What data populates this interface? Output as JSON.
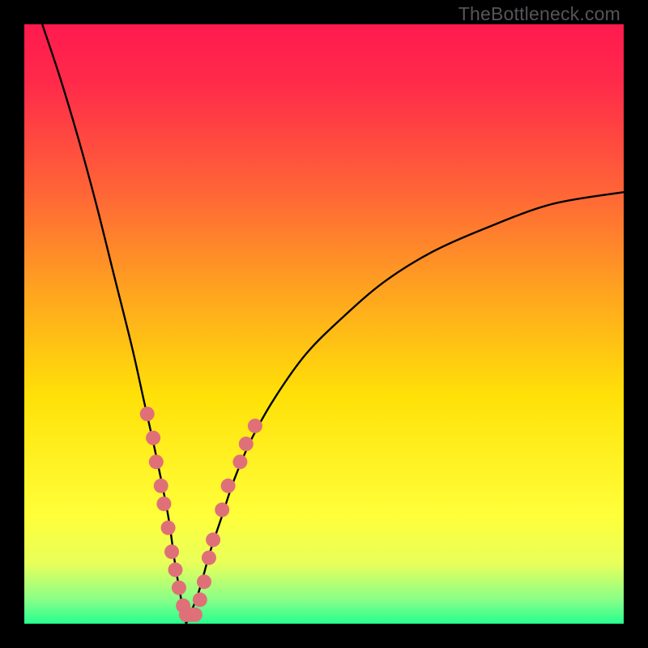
{
  "watermark": "TheBottleneck.com",
  "colors": {
    "gradient_stops": [
      {
        "offset": 0.0,
        "color": "#ff1a4f"
      },
      {
        "offset": 0.1,
        "color": "#ff2b4a"
      },
      {
        "offset": 0.28,
        "color": "#ff6537"
      },
      {
        "offset": 0.45,
        "color": "#ffa51f"
      },
      {
        "offset": 0.62,
        "color": "#ffe108"
      },
      {
        "offset": 0.82,
        "color": "#ffff3a"
      },
      {
        "offset": 0.9,
        "color": "#e8ff5b"
      },
      {
        "offset": 0.96,
        "color": "#88ff88"
      },
      {
        "offset": 1.0,
        "color": "#26ff8e"
      }
    ],
    "curve": "#000000",
    "dot": "#e07078",
    "frame": "#000000"
  },
  "chart_data": {
    "type": "line",
    "title": "",
    "xlabel": "",
    "ylabel": "",
    "xlim": [
      0,
      100
    ],
    "ylim": [
      0,
      100
    ],
    "note": "V-shaped bottleneck curve. Values on a 0-100 normalized scale; minimum sits near x≈27, y≈0. Left branch falls from top-left corner; right branch rises toward top-right but tops out around y≈72.",
    "series": [
      {
        "name": "left-branch",
        "x": [
          3,
          6,
          9,
          12,
          15,
          18,
          20,
          22,
          24,
          25,
          26,
          27
        ],
        "y": [
          100,
          91,
          81,
          70,
          58,
          46,
          37,
          28,
          18,
          11,
          5,
          0
        ]
      },
      {
        "name": "right-branch",
        "x": [
          27,
          29,
          31,
          33,
          35,
          38,
          42,
          47,
          53,
          60,
          68,
          77,
          88,
          100
        ],
        "y": [
          0,
          5,
          12,
          18,
          24,
          31,
          38,
          45,
          51,
          57,
          62,
          66,
          70,
          72
        ]
      }
    ],
    "dots": {
      "name": "highlighted-points",
      "note": "Salmon dots clustered on the lower portion of both branches near the vertex.",
      "points": [
        {
          "x": 20.5,
          "y": 35
        },
        {
          "x": 21.5,
          "y": 31
        },
        {
          "x": 22.0,
          "y": 27
        },
        {
          "x": 22.8,
          "y": 23
        },
        {
          "x": 23.3,
          "y": 20
        },
        {
          "x": 24.0,
          "y": 16
        },
        {
          "x": 24.6,
          "y": 12
        },
        {
          "x": 25.2,
          "y": 9
        },
        {
          "x": 25.8,
          "y": 6
        },
        {
          "x": 26.5,
          "y": 3
        },
        {
          "x": 27.0,
          "y": 1.5
        },
        {
          "x": 27.8,
          "y": 1.5
        },
        {
          "x": 28.5,
          "y": 1.5
        },
        {
          "x": 29.3,
          "y": 4
        },
        {
          "x": 30.0,
          "y": 7
        },
        {
          "x": 30.8,
          "y": 11
        },
        {
          "x": 31.5,
          "y": 14
        },
        {
          "x": 33.0,
          "y": 19
        },
        {
          "x": 34.0,
          "y": 23
        },
        {
          "x": 36.0,
          "y": 27
        },
        {
          "x": 37.0,
          "y": 30
        },
        {
          "x": 38.5,
          "y": 33
        }
      ]
    }
  }
}
